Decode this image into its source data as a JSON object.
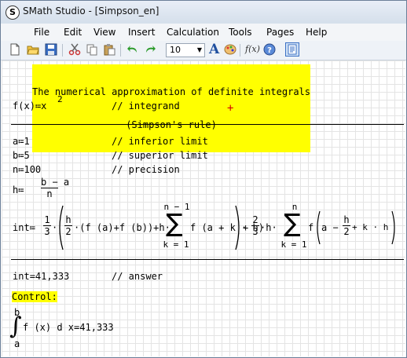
{
  "window": {
    "title": "SMath Studio - [Simpson_en]",
    "app_icon": "smath-logo-icon"
  },
  "menu": [
    "File",
    "Edit",
    "View",
    "Insert",
    "Calculation",
    "Tools",
    "Pages",
    "Help"
  ],
  "toolbar": {
    "icons": [
      "new-document-icon",
      "open-folder-icon",
      "save-icon",
      "cut-icon",
      "copy-icon",
      "paste-icon",
      "undo-icon",
      "redo-icon",
      "font-size",
      "text-style-icon",
      "palette-icon",
      "function-icon",
      "help-icon",
      "page-view-icon"
    ],
    "font_size": "10",
    "text_style_label": "A",
    "function_label": "f(x)"
  },
  "worksheet": {
    "title_line1": "The numerical approximation of definite integrals",
    "title_line2": "(Simpson's rule)",
    "f_def": {
      "lhs": "f",
      "arg": "x",
      "assign": "≔",
      "rhs": "x",
      "exp": "2",
      "comment": "// integrand"
    },
    "a_def": {
      "lhs": "a",
      "rhs": "1",
      "comment": "// inferior limit"
    },
    "b_def": {
      "lhs": "b",
      "rhs": "5",
      "comment": "// superior limit"
    },
    "n_def": {
      "lhs": "n",
      "rhs": "100",
      "comment": "// precision"
    },
    "h_def": {
      "lhs": "h",
      "num": "b − a",
      "den": "n"
    },
    "int_def": {
      "lhs": "int",
      "frac1_num": "1",
      "frac1_den": "3",
      "frac2_num": "h",
      "frac2_den": "2",
      "fa": "f (a)",
      "fb": "f (b)",
      "h": "h",
      "sum1_upper": "n − 1",
      "sum1_lower": "k = 1",
      "sum1_body": "f (a + k · h)",
      "frac3_num": "2",
      "frac3_den": "3",
      "h2": "h",
      "sum2_upper": "n",
      "sum2_lower": "k = 1",
      "sum2_body_f": "f",
      "sum2_body_a": "a −",
      "frac4_num": "h",
      "frac4_den": "2",
      "sum2_body_tail": "+ k · h"
    },
    "result": {
      "lhs": "int",
      "value": "41,333",
      "comment": "// answer"
    },
    "control_label": "Control:",
    "integral": {
      "upper": "b",
      "lower": "a",
      "body": "f (x) d x",
      "value": "41,333"
    }
  },
  "colors": {
    "highlight": "#ffff00",
    "grid": "#e4e4e4",
    "marker": "#d40000"
  }
}
